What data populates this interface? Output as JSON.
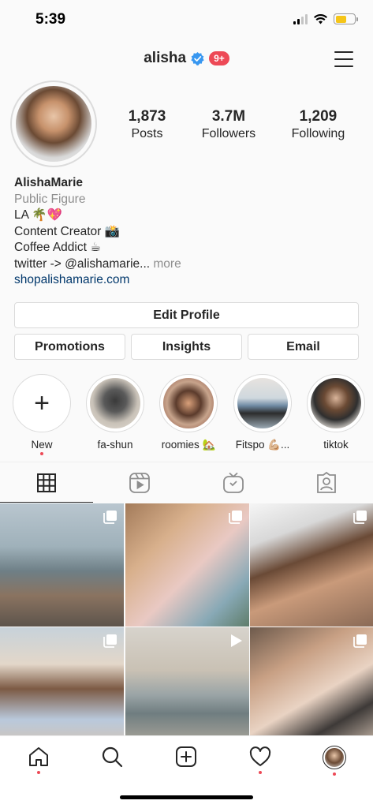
{
  "status_bar": {
    "time": "5:39"
  },
  "header": {
    "username": "alisha",
    "notification_count": "9+"
  },
  "stats": [
    {
      "value": "1,873",
      "label": "Posts"
    },
    {
      "value": "3.7M",
      "label": "Followers"
    },
    {
      "value": "1,209",
      "label": "Following"
    }
  ],
  "bio": {
    "name": "AlishaMarie",
    "category": "Public Figure",
    "line1": "LA 🌴💖",
    "line2": "Content Creator 📸",
    "line3": "Coffee Addict ☕",
    "line4": "twitter -> @alishamarie...",
    "more": "more",
    "link": "shopalishamarie.com"
  },
  "buttons": {
    "edit_profile": "Edit Profile",
    "promotions": "Promotions",
    "insights": "Insights",
    "email": "Email"
  },
  "highlights": [
    {
      "label": "New"
    },
    {
      "label": "fa-shun"
    },
    {
      "label": "roomies 🏡"
    },
    {
      "label": "Fitspo 💪🏼..."
    },
    {
      "label": "tiktok"
    }
  ],
  "colors": {
    "accent_red": "#ed4956",
    "verified_blue": "#3897f0",
    "link_blue": "#00376b"
  },
  "tabs": [
    {
      "icon": "grid-icon",
      "active": true
    },
    {
      "icon": "reels-icon",
      "active": false
    },
    {
      "icon": "igtv-icon",
      "active": false
    },
    {
      "icon": "tagged-icon",
      "active": false
    }
  ],
  "posts": [
    {
      "type": "carousel"
    },
    {
      "type": "carousel"
    },
    {
      "type": "carousel"
    },
    {
      "type": "carousel"
    },
    {
      "type": "video"
    },
    {
      "type": "carousel"
    }
  ],
  "bottom_nav": [
    {
      "icon": "home-icon"
    },
    {
      "icon": "search-icon"
    },
    {
      "icon": "new-post-icon"
    },
    {
      "icon": "activity-heart-icon"
    },
    {
      "icon": "profile-avatar-icon"
    }
  ]
}
